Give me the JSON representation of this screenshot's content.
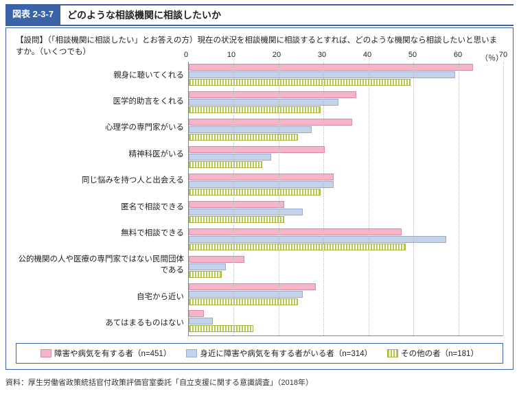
{
  "header": {
    "badge": "図表 2-3-7",
    "title": "どのような相談機関に相談したいか"
  },
  "question": {
    "lead": "【設問】（「相談機関に相談したい」とお答えの方）現在の状況を相談機関に相談するとすれば、どのような機関なら相談したいと思いますか。（いくつでも）",
    "unit": "（％）"
  },
  "legend": {
    "series1": "障害や病気を有する者（n=451）",
    "series2": "身近に障害や病気を有する者がいる者（n=314）",
    "series3": "その他の者（n=181）"
  },
  "source": "資料：厚生労働省政策統括官付政策評価官室委託「自立支援に関する意識調査」（2018年）",
  "chart_data": {
    "type": "bar",
    "orientation": "horizontal",
    "xlabel": "",
    "ylabel": "",
    "xlim": [
      0,
      70
    ],
    "xticks": [
      0,
      10,
      20,
      30,
      40,
      50,
      60,
      70
    ],
    "categories": [
      "親身に聴いてくれる",
      "医学的助言をくれる",
      "心理学の専門家がいる",
      "精神科医がいる",
      "同じ悩みを持つ人と出会える",
      "匿名で相談できる",
      "無料で相談できる",
      "公的機関の人や医療の専門家ではない民間団体である",
      "自宅から近い",
      "あてはまるものはない"
    ],
    "series": [
      {
        "name": "障害や病気を有する者（n=451）",
        "values": [
          63,
          37,
          36,
          30,
          32,
          21,
          47,
          12,
          28,
          3
        ]
      },
      {
        "name": "身近に障害や病気を有する者がいる者（n=314）",
        "values": [
          59,
          33,
          27,
          18,
          32,
          25,
          57,
          8,
          25,
          5
        ]
      },
      {
        "name": "その他の者（n=181）",
        "values": [
          49,
          29,
          24,
          16,
          29,
          21,
          48,
          7,
          24,
          14
        ]
      }
    ]
  }
}
